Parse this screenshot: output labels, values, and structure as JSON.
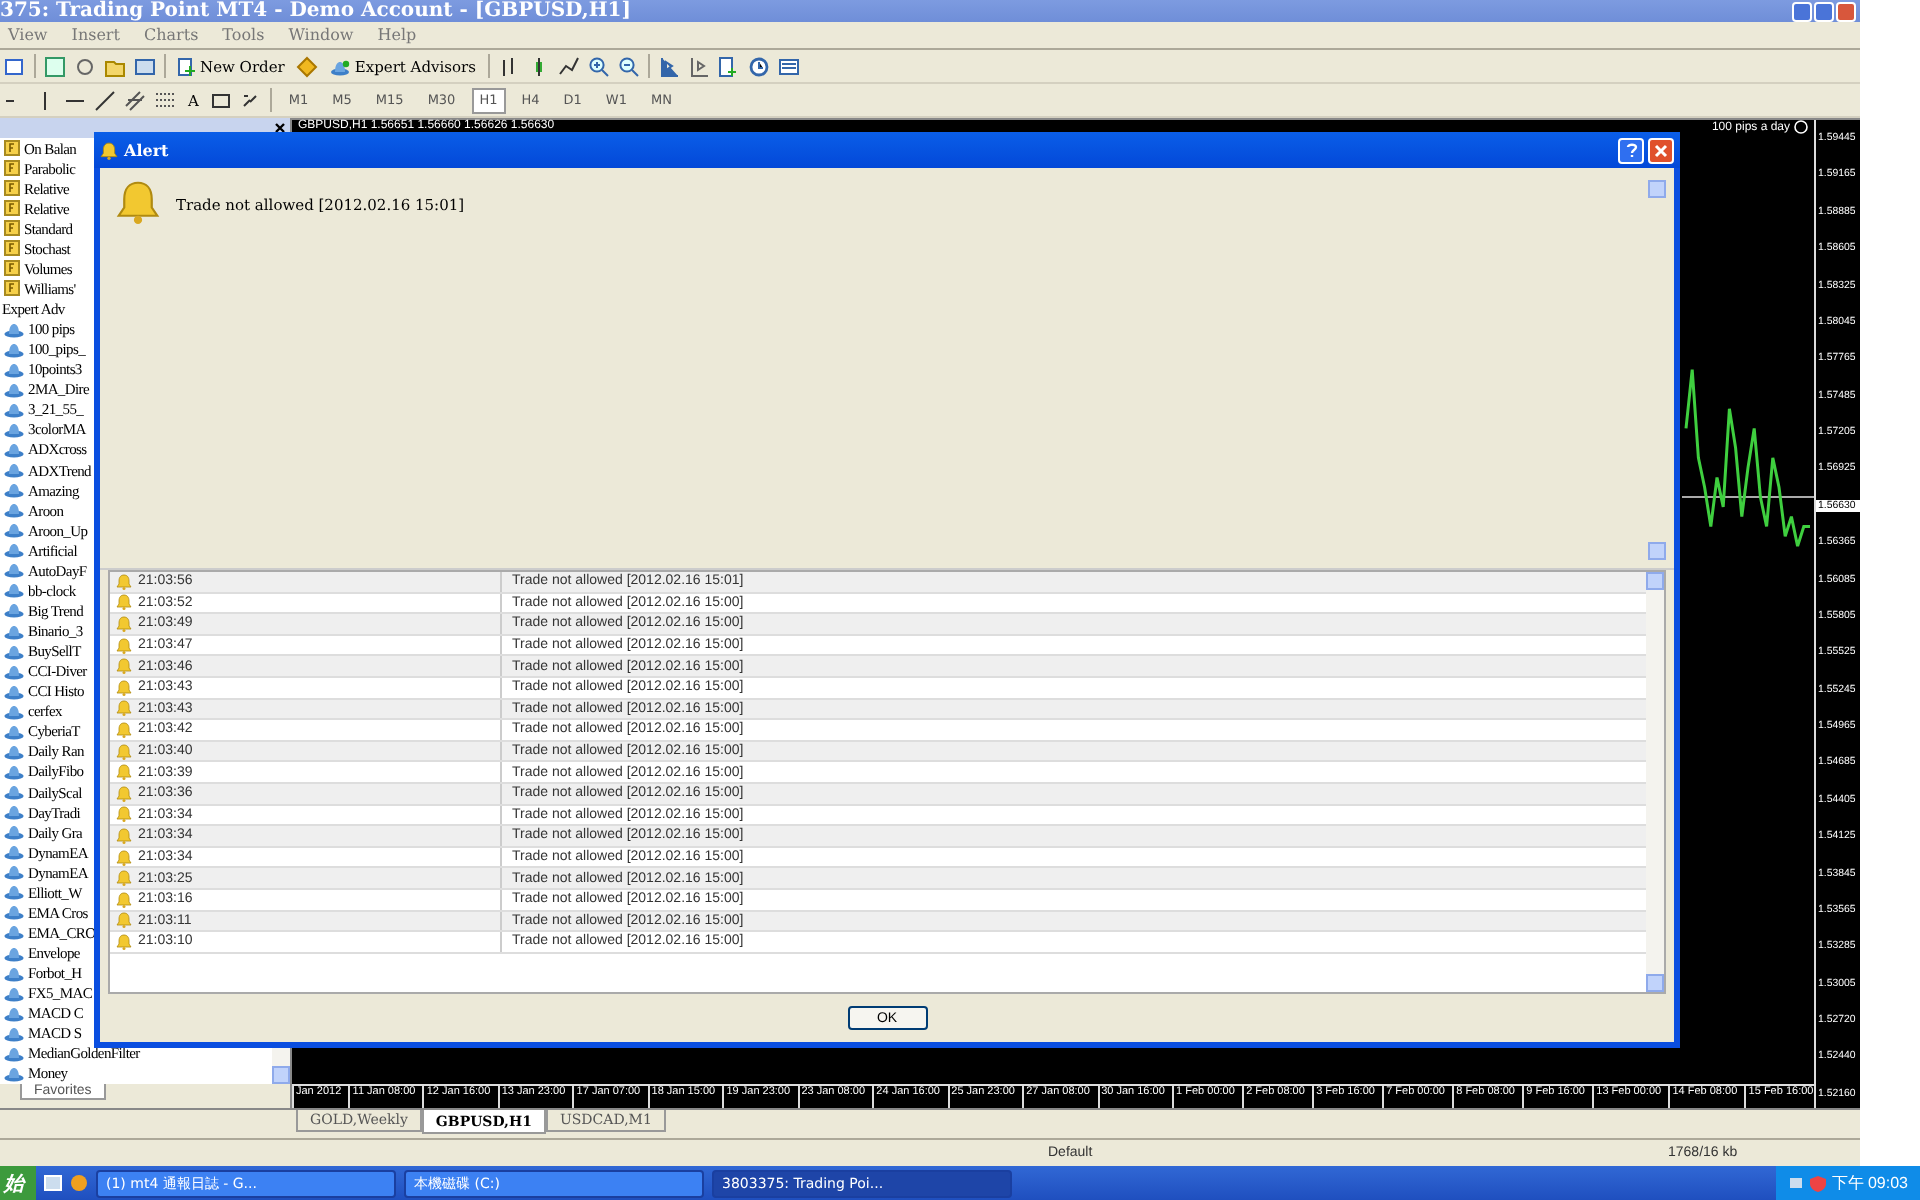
{
  "window": {
    "title": "375: Trading Point MT4 - Demo Account - [GBPUSD,H1]"
  },
  "menu": [
    "View",
    "Insert",
    "Charts",
    "Tools",
    "Window",
    "Help"
  ],
  "toolbar": {
    "new_order": "New Order",
    "expert_advisors": "Expert Advisors",
    "text_tool": "A",
    "periods": [
      {
        "label": "M1",
        "selected": false
      },
      {
        "label": "M5",
        "selected": false
      },
      {
        "label": "M15",
        "selected": false
      },
      {
        "label": "M30",
        "selected": false
      },
      {
        "label": "H1",
        "selected": true
      },
      {
        "label": "H4",
        "selected": false
      },
      {
        "label": "D1",
        "selected": false
      },
      {
        "label": "W1",
        "selected": false
      },
      {
        "label": "MN",
        "selected": false
      }
    ]
  },
  "navigator": {
    "items": [
      {
        "kind": "indicator",
        "label": "On Balan"
      },
      {
        "kind": "indicator",
        "label": "Parabolic"
      },
      {
        "kind": "indicator",
        "label": "Relative"
      },
      {
        "kind": "indicator",
        "label": "Relative"
      },
      {
        "kind": "indicator",
        "label": "Standard"
      },
      {
        "kind": "indicator",
        "label": "Stochast"
      },
      {
        "kind": "indicator",
        "label": "Volumes"
      },
      {
        "kind": "indicator",
        "label": "Williams'"
      },
      {
        "kind": "group",
        "label": "Expert Adv"
      },
      {
        "kind": "expert",
        "label": "100 pips"
      },
      {
        "kind": "expert",
        "label": "100_pips_"
      },
      {
        "kind": "expert",
        "label": "10points3"
      },
      {
        "kind": "expert",
        "label": "2MA_Dire"
      },
      {
        "kind": "expert",
        "label": "3_21_55_"
      },
      {
        "kind": "expert",
        "label": "3colorMA"
      },
      {
        "kind": "expert",
        "label": "ADXcross"
      },
      {
        "kind": "expert",
        "label": "ADXTrend"
      },
      {
        "kind": "expert",
        "label": "Amazing"
      },
      {
        "kind": "expert",
        "label": "Aroon"
      },
      {
        "kind": "expert",
        "label": "Aroon_Up"
      },
      {
        "kind": "expert",
        "label": "Artificial"
      },
      {
        "kind": "expert",
        "label": "AutoDayF"
      },
      {
        "kind": "expert",
        "label": "bb-clock"
      },
      {
        "kind": "expert",
        "label": "Big Trend"
      },
      {
        "kind": "expert",
        "label": "Binario_3"
      },
      {
        "kind": "expert",
        "label": "BuySellT"
      },
      {
        "kind": "expert",
        "label": "CCI-Diver"
      },
      {
        "kind": "expert",
        "label": "CCI Histo"
      },
      {
        "kind": "expert",
        "label": "cerfex"
      },
      {
        "kind": "expert",
        "label": "CyberiaT"
      },
      {
        "kind": "expert",
        "label": "Daily Ran"
      },
      {
        "kind": "expert",
        "label": "DailyFibo"
      },
      {
        "kind": "expert",
        "label": "DailyScal"
      },
      {
        "kind": "expert",
        "label": "DayTradi"
      },
      {
        "kind": "expert",
        "label": "Daily Gra"
      },
      {
        "kind": "expert",
        "label": "DynamEA"
      },
      {
        "kind": "expert",
        "label": "DynamEA"
      },
      {
        "kind": "expert",
        "label": "Elliott_W"
      },
      {
        "kind": "expert",
        "label": "EMA Cros"
      },
      {
        "kind": "expert",
        "label": "EMA_CRO"
      },
      {
        "kind": "expert",
        "label": "Envelope"
      },
      {
        "kind": "expert",
        "label": "Forbot_H"
      },
      {
        "kind": "expert",
        "label": "FX5_MAC"
      },
      {
        "kind": "expert",
        "label": "MACD C"
      },
      {
        "kind": "expert",
        "label": "MACD S"
      },
      {
        "kind": "expert",
        "label": "MedianGoldenFilter"
      },
      {
        "kind": "expert",
        "label": "Money"
      }
    ],
    "tab": "Favorites"
  },
  "chart": {
    "header": "GBPUSD,H1  1.56651 1.56660 1.56626 1.56630",
    "expert": "100 pips a day",
    "prices": [
      {
        "label": "1.59445",
        "current": false
      },
      {
        "label": "1.59165",
        "current": false
      },
      {
        "label": "1.58885",
        "current": false
      },
      {
        "label": "1.58605",
        "current": false
      },
      {
        "label": "1.58325",
        "current": false
      },
      {
        "label": "1.58045",
        "current": false
      },
      {
        "label": "1.57765",
        "current": false
      },
      {
        "label": "1.57485",
        "current": false
      },
      {
        "label": "1.57205",
        "current": false
      },
      {
        "label": "1.56925",
        "current": false
      },
      {
        "label": "1.56630",
        "current": true
      },
      {
        "label": "1.56365",
        "current": false
      },
      {
        "label": "1.56085",
        "current": false
      },
      {
        "label": "1.55805",
        "current": false
      },
      {
        "label": "1.55525",
        "current": false
      },
      {
        "label": "1.55245",
        "current": false
      },
      {
        "label": "1.54965",
        "current": false
      },
      {
        "label": "1.54685",
        "current": false
      },
      {
        "label": "1.54405",
        "current": false
      },
      {
        "label": "1.54125",
        "current": false
      },
      {
        "label": "1.53845",
        "current": false
      },
      {
        "label": "1.53565",
        "current": false
      },
      {
        "label": "1.53285",
        "current": false
      },
      {
        "label": "1.53005",
        "current": false
      },
      {
        "label": "1.52720",
        "current": false
      },
      {
        "label": "1.52440",
        "current": false
      },
      {
        "label": "1.52160",
        "current": false
      }
    ],
    "times": [
      "Jan 2012",
      "11 Jan 08:00",
      "12 Jan 16:00",
      "13 Jan 23:00",
      "17 Jan 07:00",
      "18 Jan 15:00",
      "19 Jan 23:00",
      "23 Jan 08:00",
      "24 Jan 16:00",
      "25 Jan 23:00",
      "27 Jan 08:00",
      "30 Jan 16:00",
      "1 Feb 00:00",
      "2 Feb 08:00",
      "3 Feb 16:00",
      "7 Feb 00:00",
      "8 Feb 08:00",
      "9 Feb 16:00",
      "13 Feb 00:00",
      "14 Feb 08:00",
      "15 Feb 16:00"
    ]
  },
  "chart_tabs": [
    {
      "label": "GOLD,Weekly",
      "selected": false
    },
    {
      "label": "GBPUSD,H1",
      "selected": true
    },
    {
      "label": "USDCAD,M1",
      "selected": false
    }
  ],
  "status_bar": {
    "profile": "Default",
    "traffic": "1768/16 kb"
  },
  "alert": {
    "title": "Alert",
    "message": "Trade not allowed [2012.02.16 15:01]",
    "ok": "OK",
    "rows": [
      {
        "time": "21:03:56",
        "message": "Trade not allowed [2012.02.16 15:01]"
      },
      {
        "time": "21:03:52",
        "message": "Trade not allowed [2012.02.16 15:00]"
      },
      {
        "time": "21:03:49",
        "message": "Trade not allowed [2012.02.16 15:00]"
      },
      {
        "time": "21:03:47",
        "message": "Trade not allowed [2012.02.16 15:00]"
      },
      {
        "time": "21:03:46",
        "message": "Trade not allowed [2012.02.16 15:00]"
      },
      {
        "time": "21:03:43",
        "message": "Trade not allowed [2012.02.16 15:00]"
      },
      {
        "time": "21:03:43",
        "message": "Trade not allowed [2012.02.16 15:00]"
      },
      {
        "time": "21:03:42",
        "message": "Trade not allowed [2012.02.16 15:00]"
      },
      {
        "time": "21:03:40",
        "message": "Trade not allowed [2012.02.16 15:00]"
      },
      {
        "time": "21:03:39",
        "message": "Trade not allowed [2012.02.16 15:00]"
      },
      {
        "time": "21:03:36",
        "message": "Trade not allowed [2012.02.16 15:00]"
      },
      {
        "time": "21:03:34",
        "message": "Trade not allowed [2012.02.16 15:00]"
      },
      {
        "time": "21:03:34",
        "message": "Trade not allowed [2012.02.16 15:00]"
      },
      {
        "time": "21:03:34",
        "message": "Trade not allowed [2012.02.16 15:00]"
      },
      {
        "time": "21:03:25",
        "message": "Trade not allowed [2012.02.16 15:00]"
      },
      {
        "time": "21:03:16",
        "message": "Trade not allowed [2012.02.16 15:00]"
      },
      {
        "time": "21:03:11",
        "message": "Trade not allowed [2012.02.16 15:00]"
      },
      {
        "time": "21:03:10",
        "message": "Trade not allowed [2012.02.16 15:00]"
      }
    ]
  },
  "taskbar": {
    "start": "始",
    "items": [
      {
        "label": "(1) mt4 通報日誌 - G...",
        "selected": false
      },
      {
        "label": "本機磁碟 (C:)",
        "selected": false
      },
      {
        "label": "3803375: Trading Poi...",
        "selected": true
      }
    ],
    "clock": "下午 09:03"
  }
}
